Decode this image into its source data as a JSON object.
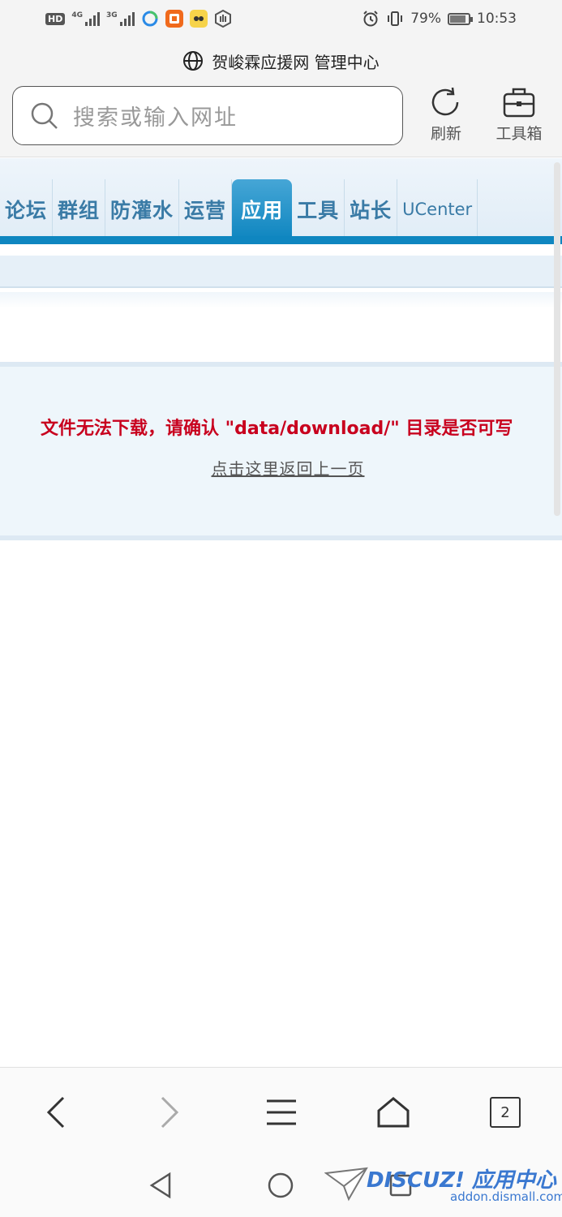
{
  "status_bar": {
    "hd_badge": "HD",
    "signal1_tag": "4G",
    "signal2_tag": "3G",
    "battery": "79%",
    "time": "10:53"
  },
  "page_title": "贺峻霖应援网 管理中心",
  "address_bar": {
    "placeholder": "搜索或输入网址"
  },
  "toolbar": {
    "refresh_label": "刷新",
    "toolbox_label": "工具箱"
  },
  "nav": {
    "tabs": [
      {
        "label": "论坛"
      },
      {
        "label": "群组"
      },
      {
        "label": "防灌水"
      },
      {
        "label": "运营"
      },
      {
        "label": "应用"
      },
      {
        "label": "工具"
      },
      {
        "label": "站长"
      },
      {
        "label": "UCenter"
      }
    ],
    "active_tab": "应用"
  },
  "message": {
    "error": "文件无法下载，请确认 \"data/download/\" 目录是否可写",
    "back_link": "点击这里返回上一页"
  },
  "browser_nav": {
    "tab_count": "2"
  },
  "watermark": {
    "brand": "DISCUZ! 应用中心",
    "url": "addon.dismall.com"
  },
  "colors": {
    "accent": "#0f86c0",
    "error": "#c8001e",
    "nav_text": "#3a7ba6"
  }
}
